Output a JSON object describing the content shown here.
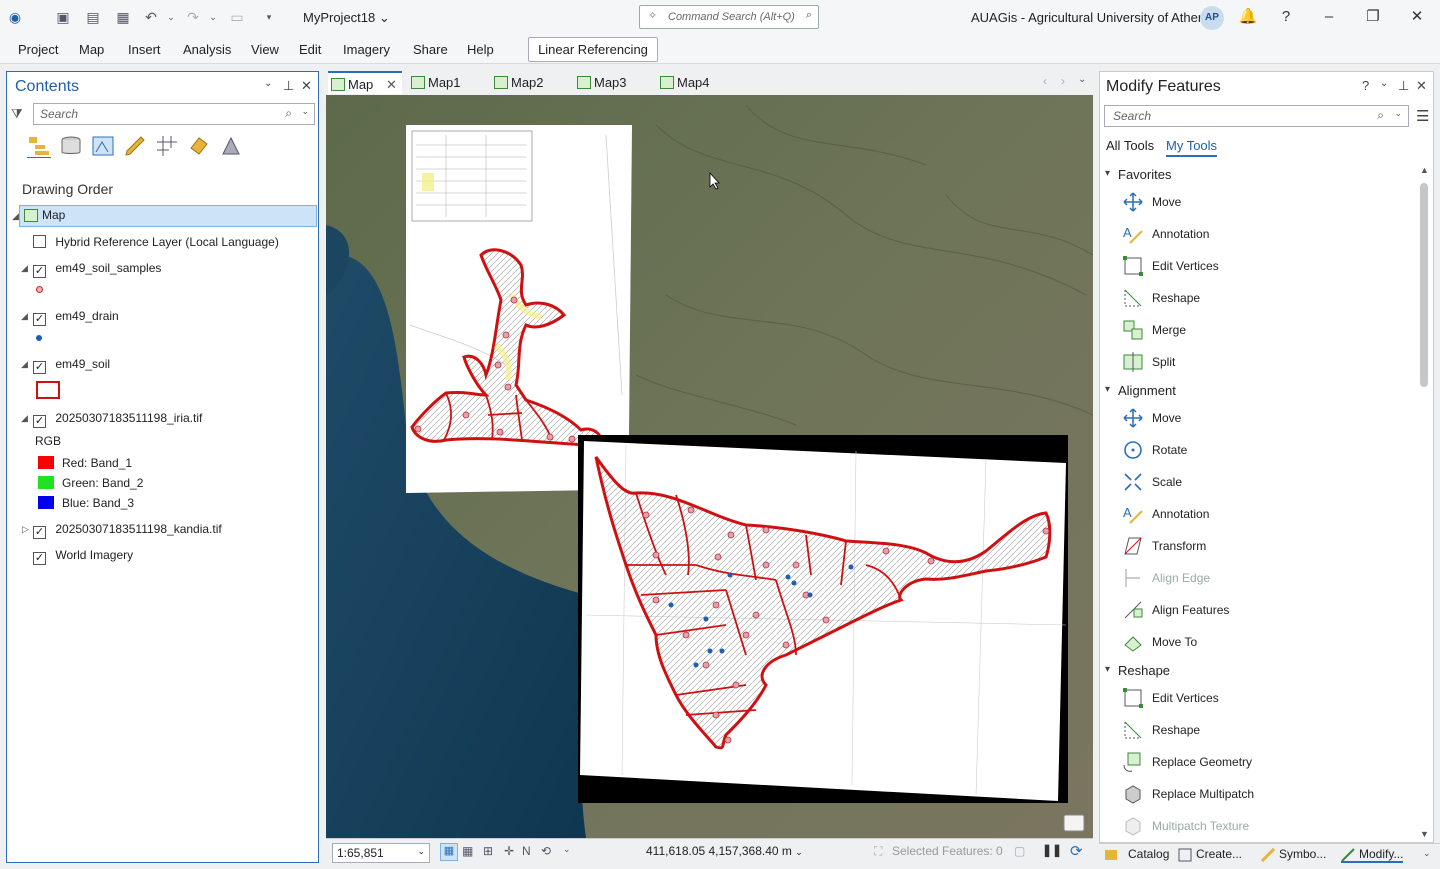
{
  "titlebar": {
    "project": "MyProject18",
    "command_search_placeholder": "Command Search (Alt+Q)",
    "organization": "AUAGis - Agricultural University of Athens",
    "avatar_initials": "AP"
  },
  "menubar": {
    "items": [
      "Project",
      "Map",
      "Insert",
      "Analysis",
      "View",
      "Edit",
      "Imagery",
      "Share",
      "Help"
    ],
    "contextual_tab": "Linear Referencing"
  },
  "contents": {
    "title": "Contents",
    "search_placeholder": "Search",
    "drawing_order": "Drawing Order",
    "map_node": "Map",
    "layers": {
      "hybrid": "Hybrid Reference Layer (Local Language)",
      "soil_samples": "em49_soil_samples",
      "drain": "em49_drain",
      "soil": "em49_soil",
      "iria": "20250307183511198_iria.tif",
      "rgb": "RGB",
      "red": "Red:  Band_1",
      "green": "Green: Band_2",
      "blue": "Blue:  Band_3",
      "kandia": "20250307183511198_kandia.tif",
      "world": "World Imagery"
    }
  },
  "map_tabs": [
    "Map",
    "Map1",
    "Map2",
    "Map3",
    "Map4"
  ],
  "status": {
    "scale": "1:65,851",
    "coordinates": "411,618.05 4,157,368.40 m",
    "selected_features": "Selected Features: 0"
  },
  "modify": {
    "title": "Modify Features",
    "search_placeholder": "Search",
    "tab_all": "All Tools",
    "tab_my": "My Tools",
    "favorites": {
      "label": "Favorites",
      "tools": [
        "Move",
        "Annotation",
        "Edit Vertices",
        "Reshape",
        "Merge",
        "Split"
      ]
    },
    "alignment": {
      "label": "Alignment",
      "tools": [
        "Move",
        "Rotate",
        "Scale",
        "Annotation",
        "Transform",
        "Align Edge",
        "Align Features",
        "Move To"
      ]
    },
    "reshape": {
      "label": "Reshape",
      "tools": [
        "Edit Vertices",
        "Reshape",
        "Replace Geometry",
        "Replace Multipatch",
        "Multipatch Texture"
      ]
    }
  },
  "bottom_tabs": [
    "Catalog",
    "Create...",
    "Symbo...",
    "Modify..."
  ],
  "colors": {
    "accent": "#2a6fb5",
    "feature_outline": "#d01010",
    "selection": "#cde3f7"
  }
}
